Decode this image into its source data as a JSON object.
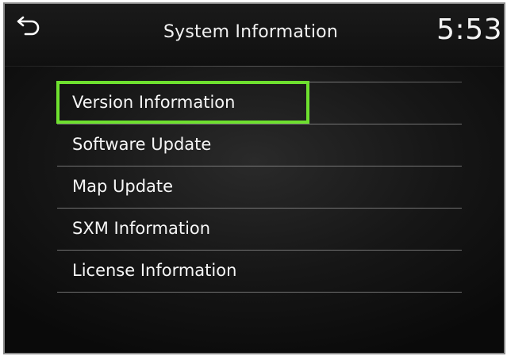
{
  "header": {
    "back_icon": "back-arrow-icon",
    "title": "System Information",
    "clock": "5:53"
  },
  "menu": {
    "items": [
      {
        "label": "Version Information",
        "highlighted": true
      },
      {
        "label": "Software Update"
      },
      {
        "label": "Map Update"
      },
      {
        "label": "SXM Information"
      },
      {
        "label": "License Information"
      }
    ]
  },
  "colors": {
    "highlight": "#6ee02f",
    "background": "#161616",
    "text": "#f6f6f6"
  }
}
